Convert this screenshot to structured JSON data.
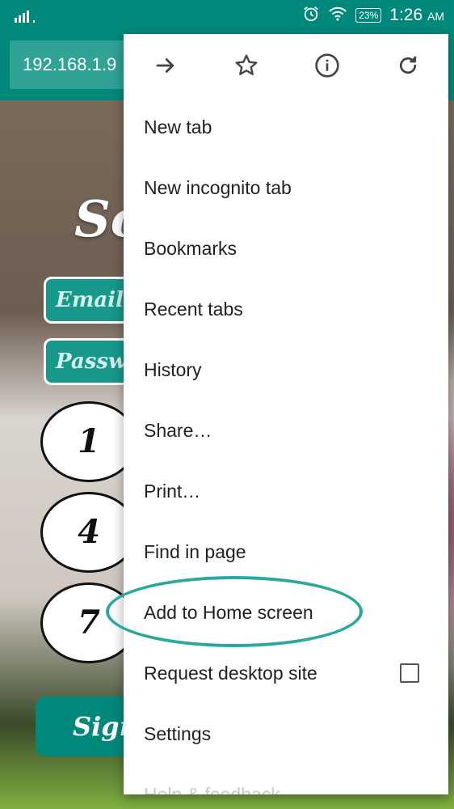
{
  "status_bar": {
    "battery": "23%",
    "time": "1:26",
    "ampm": "AM",
    "icons": [
      "signal-icon",
      "alarm-icon",
      "wifi-icon",
      "battery-icon"
    ]
  },
  "toolbar": {
    "url": "192.168.1.9"
  },
  "page": {
    "title": "So",
    "email_placeholder": "Email",
    "password_placeholder": "Passwo",
    "keys": [
      "1",
      "4",
      "7"
    ],
    "signin_label": "Sign"
  },
  "menu": {
    "toolbar_icons": [
      "forward-icon",
      "bookmark-star-icon",
      "page-info-icon",
      "reload-icon"
    ],
    "items": [
      {
        "label": "New tab"
      },
      {
        "label": "New incognito tab"
      },
      {
        "label": "Bookmarks"
      },
      {
        "label": "Recent tabs"
      },
      {
        "label": "History"
      },
      {
        "label": "Share…"
      },
      {
        "label": "Print…"
      },
      {
        "label": "Find in page"
      },
      {
        "label": "Add to Home screen"
      },
      {
        "label": "Request desktop site",
        "checked": false
      },
      {
        "label": "Settings"
      },
      {
        "label": "Help & feedback"
      }
    ]
  },
  "colors": {
    "accent": "#00897b",
    "highlight_ring": "#2aa89a"
  }
}
